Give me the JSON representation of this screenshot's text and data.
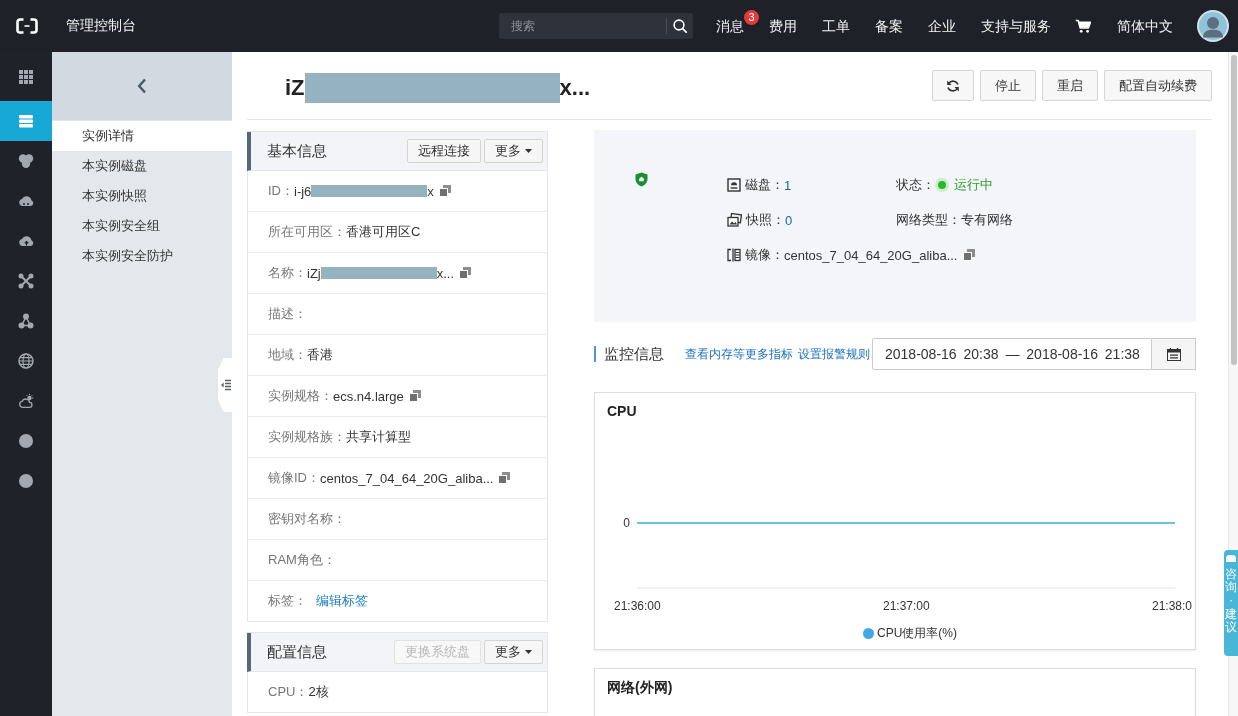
{
  "topbar": {
    "title": "管理控制台",
    "search": {
      "placeholder": "搜索"
    },
    "nav": [
      {
        "label": "消息",
        "badge": "3"
      },
      {
        "label": "费用"
      },
      {
        "label": "工单"
      },
      {
        "label": "备案"
      },
      {
        "label": "企业"
      },
      {
        "label": "支持与服务"
      }
    ],
    "language": "简体中文"
  },
  "icon_rail": {
    "items": [
      {
        "kind": "grid",
        "selected": false
      },
      {
        "kind": "server",
        "selected": true
      },
      {
        "kind": "cluster",
        "selected": false
      },
      {
        "kind": "cloud",
        "selected": false
      },
      {
        "kind": "cloud_upload",
        "selected": false
      },
      {
        "kind": "network",
        "selected": false
      },
      {
        "kind": "nodes",
        "selected": false
      },
      {
        "kind": "globe",
        "selected": false
      },
      {
        "kind": "weather",
        "selected": false
      },
      {
        "kind": "dot",
        "selected": false
      },
      {
        "kind": "dot",
        "selected": false
      }
    ]
  },
  "submenu": {
    "items": [
      {
        "label": "实例详情",
        "selected": true
      },
      {
        "label": "本实例磁盘",
        "selected": false
      },
      {
        "label": "本实例快照",
        "selected": false
      },
      {
        "label": "本实例安全组",
        "selected": false
      },
      {
        "label": "本实例安全防护",
        "selected": false
      }
    ]
  },
  "header": {
    "title": [
      {
        "kind": "text",
        "text": "iZ"
      },
      {
        "kind": "redacted"
      },
      {
        "kind": "text",
        "text": "x..."
      }
    ],
    "actions": [
      "停止",
      "重启",
      "配置自动续费"
    ]
  },
  "basic_info": {
    "title": "基本信息",
    "buttons": [
      {
        "label": "远程连接",
        "disabled": false,
        "dropdown": false
      },
      {
        "label": "更多",
        "disabled": false,
        "dropdown": true
      }
    ],
    "rows": [
      {
        "label": "ID：",
        "value": [
          {
            "kind": "text",
            "text": "i-j6"
          },
          {
            "kind": "redacted"
          },
          {
            "kind": "text",
            "text": "x"
          }
        ],
        "copyable": true
      },
      {
        "label": "所在可用区：",
        "value": [
          {
            "kind": "text",
            "text": "香港可用区C"
          }
        ],
        "copyable": false
      },
      {
        "label": "名称：",
        "value": [
          {
            "kind": "text",
            "text": "iZj"
          },
          {
            "kind": "redacted"
          },
          {
            "kind": "text",
            "text": "x..."
          }
        ],
        "copyable": true
      },
      {
        "label": "描述：",
        "copyable": false
      },
      {
        "label": "地域：",
        "value": [
          {
            "kind": "text",
            "text": "香港"
          }
        ],
        "copyable": false
      },
      {
        "label": "实例规格：",
        "value": [
          {
            "kind": "text",
            "text": "ecs.n4.large"
          }
        ],
        "copyable": true
      },
      {
        "label": "实例规格族：",
        "value": [
          {
            "kind": "text",
            "text": "共享计算型"
          }
        ],
        "copyable": false
      },
      {
        "label": "镜像ID：",
        "value": [
          {
            "kind": "text",
            "text": "centos_7_04_64_20G_aliba..."
          }
        ],
        "copyable": true
      },
      {
        "label": "密钥对名称：",
        "copyable": false
      },
      {
        "label": "RAM角色：",
        "copyable": false
      },
      {
        "label": "标签：",
        "value": [
          {
            "kind": "link",
            "text": "编辑标签"
          }
        ],
        "copyable": false
      }
    ]
  },
  "config_info": {
    "title": "配置信息",
    "buttons": [
      {
        "label": "更换系统盘",
        "disabled": true,
        "dropdown": false
      },
      {
        "label": "更多",
        "disabled": false,
        "dropdown": true
      }
    ],
    "rows": [
      {
        "label": "CPU：",
        "value": [
          {
            "kind": "text",
            "text": "2核"
          }
        ],
        "copyable": false
      }
    ]
  },
  "summary": {
    "left": [
      {
        "kind": "disk",
        "label": "磁盘：",
        "value": "1",
        "copyable": false
      },
      {
        "kind": "snapshot",
        "label": "快照：",
        "value": "0",
        "copyable": false
      },
      {
        "kind": "image",
        "label": "镜像：",
        "value": "centos_7_04_64_20G_aliba...",
        "copyable": true
      }
    ],
    "right": [
      {
        "kind": "status",
        "label": "状态：",
        "value": "运行中",
        "copyable": false
      },
      {
        "kind": "text",
        "label": "网络类型：",
        "value": "专有网络",
        "copyable": false
      }
    ]
  },
  "monitor": {
    "title": "监控信息",
    "links": [
      "查看内存等更多指标",
      "设置报警规则"
    ],
    "range": "2018-08-16 20:38 — 2018-08-16 21:38"
  },
  "charts": [
    {
      "title": "CPU",
      "y_labels": [
        "0"
      ],
      "x_labels": [
        "21:36:00",
        "21:37:00",
        "21:38:0"
      ],
      "legend": [
        {
          "name": "CPU使用率(%)",
          "color": "#3ea9e6"
        }
      ]
    },
    {
      "title": "网络(外网)"
    }
  ],
  "feedback": "咨询·建议"
}
